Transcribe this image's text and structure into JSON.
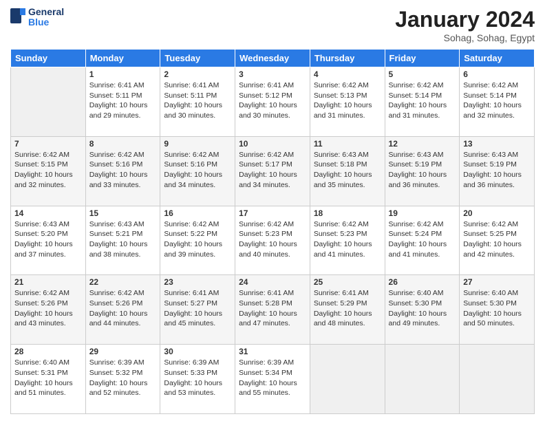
{
  "header": {
    "logo_line1": "General",
    "logo_line2": "Blue",
    "month": "January 2024",
    "location": "Sohag, Sohag, Egypt"
  },
  "days_of_week": [
    "Sunday",
    "Monday",
    "Tuesday",
    "Wednesday",
    "Thursday",
    "Friday",
    "Saturday"
  ],
  "weeks": [
    [
      {
        "day": "",
        "sunrise": "",
        "sunset": "",
        "daylight": ""
      },
      {
        "day": "1",
        "sunrise": "Sunrise: 6:41 AM",
        "sunset": "Sunset: 5:11 PM",
        "daylight": "Daylight: 10 hours and 29 minutes."
      },
      {
        "day": "2",
        "sunrise": "Sunrise: 6:41 AM",
        "sunset": "Sunset: 5:11 PM",
        "daylight": "Daylight: 10 hours and 30 minutes."
      },
      {
        "day": "3",
        "sunrise": "Sunrise: 6:41 AM",
        "sunset": "Sunset: 5:12 PM",
        "daylight": "Daylight: 10 hours and 30 minutes."
      },
      {
        "day": "4",
        "sunrise": "Sunrise: 6:42 AM",
        "sunset": "Sunset: 5:13 PM",
        "daylight": "Daylight: 10 hours and 31 minutes."
      },
      {
        "day": "5",
        "sunrise": "Sunrise: 6:42 AM",
        "sunset": "Sunset: 5:14 PM",
        "daylight": "Daylight: 10 hours and 31 minutes."
      },
      {
        "day": "6",
        "sunrise": "Sunrise: 6:42 AM",
        "sunset": "Sunset: 5:14 PM",
        "daylight": "Daylight: 10 hours and 32 minutes."
      }
    ],
    [
      {
        "day": "7",
        "sunrise": "Sunrise: 6:42 AM",
        "sunset": "Sunset: 5:15 PM",
        "daylight": "Daylight: 10 hours and 32 minutes."
      },
      {
        "day": "8",
        "sunrise": "Sunrise: 6:42 AM",
        "sunset": "Sunset: 5:16 PM",
        "daylight": "Daylight: 10 hours and 33 minutes."
      },
      {
        "day": "9",
        "sunrise": "Sunrise: 6:42 AM",
        "sunset": "Sunset: 5:16 PM",
        "daylight": "Daylight: 10 hours and 34 minutes."
      },
      {
        "day": "10",
        "sunrise": "Sunrise: 6:42 AM",
        "sunset": "Sunset: 5:17 PM",
        "daylight": "Daylight: 10 hours and 34 minutes."
      },
      {
        "day": "11",
        "sunrise": "Sunrise: 6:43 AM",
        "sunset": "Sunset: 5:18 PM",
        "daylight": "Daylight: 10 hours and 35 minutes."
      },
      {
        "day": "12",
        "sunrise": "Sunrise: 6:43 AM",
        "sunset": "Sunset: 5:19 PM",
        "daylight": "Daylight: 10 hours and 36 minutes."
      },
      {
        "day": "13",
        "sunrise": "Sunrise: 6:43 AM",
        "sunset": "Sunset: 5:19 PM",
        "daylight": "Daylight: 10 hours and 36 minutes."
      }
    ],
    [
      {
        "day": "14",
        "sunrise": "Sunrise: 6:43 AM",
        "sunset": "Sunset: 5:20 PM",
        "daylight": "Daylight: 10 hours and 37 minutes."
      },
      {
        "day": "15",
        "sunrise": "Sunrise: 6:43 AM",
        "sunset": "Sunset: 5:21 PM",
        "daylight": "Daylight: 10 hours and 38 minutes."
      },
      {
        "day": "16",
        "sunrise": "Sunrise: 6:42 AM",
        "sunset": "Sunset: 5:22 PM",
        "daylight": "Daylight: 10 hours and 39 minutes."
      },
      {
        "day": "17",
        "sunrise": "Sunrise: 6:42 AM",
        "sunset": "Sunset: 5:23 PM",
        "daylight": "Daylight: 10 hours and 40 minutes."
      },
      {
        "day": "18",
        "sunrise": "Sunrise: 6:42 AM",
        "sunset": "Sunset: 5:23 PM",
        "daylight": "Daylight: 10 hours and 41 minutes."
      },
      {
        "day": "19",
        "sunrise": "Sunrise: 6:42 AM",
        "sunset": "Sunset: 5:24 PM",
        "daylight": "Daylight: 10 hours and 41 minutes."
      },
      {
        "day": "20",
        "sunrise": "Sunrise: 6:42 AM",
        "sunset": "Sunset: 5:25 PM",
        "daylight": "Daylight: 10 hours and 42 minutes."
      }
    ],
    [
      {
        "day": "21",
        "sunrise": "Sunrise: 6:42 AM",
        "sunset": "Sunset: 5:26 PM",
        "daylight": "Daylight: 10 hours and 43 minutes."
      },
      {
        "day": "22",
        "sunrise": "Sunrise: 6:42 AM",
        "sunset": "Sunset: 5:26 PM",
        "daylight": "Daylight: 10 hours and 44 minutes."
      },
      {
        "day": "23",
        "sunrise": "Sunrise: 6:41 AM",
        "sunset": "Sunset: 5:27 PM",
        "daylight": "Daylight: 10 hours and 45 minutes."
      },
      {
        "day": "24",
        "sunrise": "Sunrise: 6:41 AM",
        "sunset": "Sunset: 5:28 PM",
        "daylight": "Daylight: 10 hours and 47 minutes."
      },
      {
        "day": "25",
        "sunrise": "Sunrise: 6:41 AM",
        "sunset": "Sunset: 5:29 PM",
        "daylight": "Daylight: 10 hours and 48 minutes."
      },
      {
        "day": "26",
        "sunrise": "Sunrise: 6:40 AM",
        "sunset": "Sunset: 5:30 PM",
        "daylight": "Daylight: 10 hours and 49 minutes."
      },
      {
        "day": "27",
        "sunrise": "Sunrise: 6:40 AM",
        "sunset": "Sunset: 5:30 PM",
        "daylight": "Daylight: 10 hours and 50 minutes."
      }
    ],
    [
      {
        "day": "28",
        "sunrise": "Sunrise: 6:40 AM",
        "sunset": "Sunset: 5:31 PM",
        "daylight": "Daylight: 10 hours and 51 minutes."
      },
      {
        "day": "29",
        "sunrise": "Sunrise: 6:39 AM",
        "sunset": "Sunset: 5:32 PM",
        "daylight": "Daylight: 10 hours and 52 minutes."
      },
      {
        "day": "30",
        "sunrise": "Sunrise: 6:39 AM",
        "sunset": "Sunset: 5:33 PM",
        "daylight": "Daylight: 10 hours and 53 minutes."
      },
      {
        "day": "31",
        "sunrise": "Sunrise: 6:39 AM",
        "sunset": "Sunset: 5:34 PM",
        "daylight": "Daylight: 10 hours and 55 minutes."
      },
      {
        "day": "",
        "sunrise": "",
        "sunset": "",
        "daylight": ""
      },
      {
        "day": "",
        "sunrise": "",
        "sunset": "",
        "daylight": ""
      },
      {
        "day": "",
        "sunrise": "",
        "sunset": "",
        "daylight": ""
      }
    ]
  ]
}
